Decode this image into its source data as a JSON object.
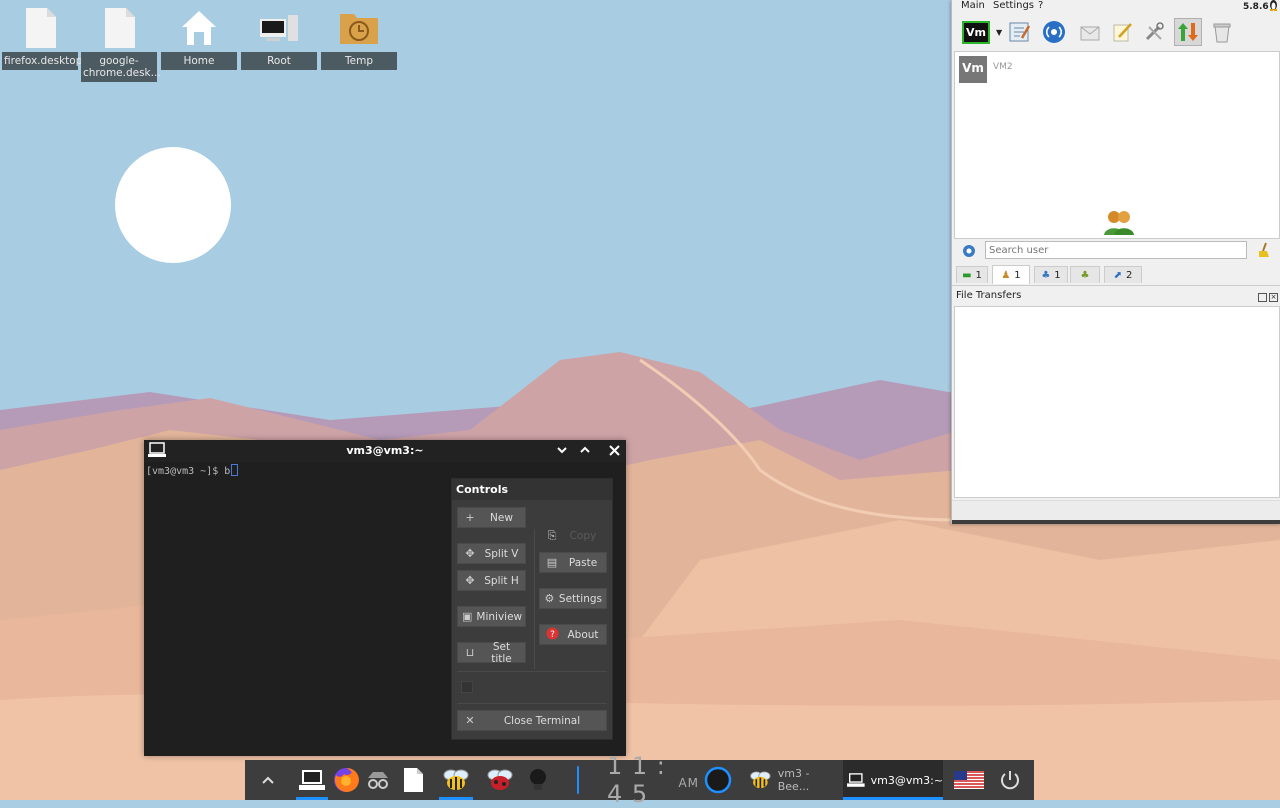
{
  "desktop": {
    "icons": [
      {
        "label": "firefox.desktop",
        "icon": "file-icon"
      },
      {
        "label": "google-chrome.desk...",
        "icon": "file-icon"
      },
      {
        "label": "Home",
        "icon": "home-icon"
      },
      {
        "label": "Root",
        "icon": "computer-icon"
      },
      {
        "label": "Temp",
        "icon": "folder-clock-icon"
      }
    ]
  },
  "terminal": {
    "title": "vm3@vm3:~",
    "prompt": "[vm3@vm3 ~]$ b",
    "controls": {
      "title": "Controls",
      "new": "New",
      "split_v": "Split V",
      "split_h": "Split H",
      "miniview": "Miniview",
      "set_title": "Set title",
      "copy": "Copy",
      "paste": "Paste",
      "settings": "Settings",
      "about": "About",
      "close_terminal": "Close Terminal"
    }
  },
  "beebeep": {
    "menu": {
      "main": "Main",
      "settings": "Settings",
      "help": "?"
    },
    "version": "5.8.6",
    "user": {
      "name": "VM2",
      "avatar": "Vm"
    },
    "toolbar_logo": "Vm",
    "search_placeholder": "Search user",
    "tabs": [
      "1",
      "1",
      "1",
      "",
      "2"
    ],
    "file_transfers": "File Transfers"
  },
  "taskbar": {
    "clock": "1 1 : 4 5",
    "clock_ampm": "AM",
    "task1": "vm3 - Bee...",
    "task2": "vm3@vm3:~"
  },
  "colors": {
    "accent": "#1e90ff",
    "taskbar": "#3d3d3d",
    "terminal_bg": "#1f1f1f"
  }
}
